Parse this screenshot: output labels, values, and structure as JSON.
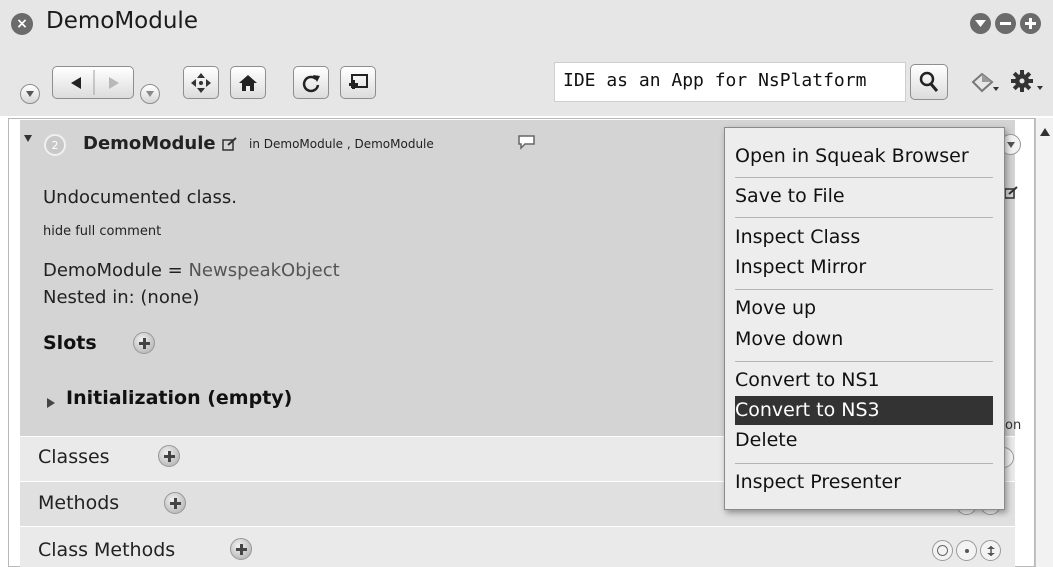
{
  "window": {
    "title": "DemoModule",
    "close_icon": "close-icon",
    "controls": [
      "collapse-icon",
      "minimize-icon",
      "maximize-icon"
    ]
  },
  "toolbar": {
    "search_value": "IDE as an App for NsPlatform",
    "icons": [
      "menu-circle-icon",
      "back-arrow-icon",
      "forward-arrow-icon",
      "menu-circle-icon",
      "move-icon",
      "home-icon",
      "refresh-icon",
      "new-window-icon",
      "search-icon",
      "tools-icon",
      "gear-icon"
    ]
  },
  "class_header": {
    "name": "DemoModule",
    "in_label": "in DemoModule , DemoModule",
    "comment_text": "Undocumented class.",
    "hide_comment_link": "hide full comment",
    "superclass_label": "DemoModule = ",
    "superclass_value": "NewspeakObject",
    "nested_label": "Nested in: ",
    "nested_value": "(none)",
    "slots_label": "Slots",
    "initialization_label": "Initialization (empty)",
    "badge": "2"
  },
  "sections": [
    {
      "label": "Classes"
    },
    {
      "label": "Methods"
    },
    {
      "label": "Class Methods"
    }
  ],
  "context_menu": {
    "items": [
      {
        "label": "Open in Squeak Browser"
      },
      {
        "label": "Save to File"
      },
      {
        "label": "Inspect Class"
      },
      {
        "label": "Inspect Mirror"
      },
      {
        "label": "Move up"
      },
      {
        "label": "Move down"
      },
      {
        "label": "Convert to NS1"
      },
      {
        "label": "Convert to NS3",
        "highlighted": true
      },
      {
        "label": "Delete"
      },
      {
        "label": "Inspect Presenter"
      }
    ]
  },
  "partial_text": "on",
  "colors": {
    "title_bar": "#e6e6e6",
    "content_bg": "#d4d4d4",
    "section_bg": "#e9e9e9",
    "highlight": "#333333",
    "menu_bg": "#ededed"
  }
}
